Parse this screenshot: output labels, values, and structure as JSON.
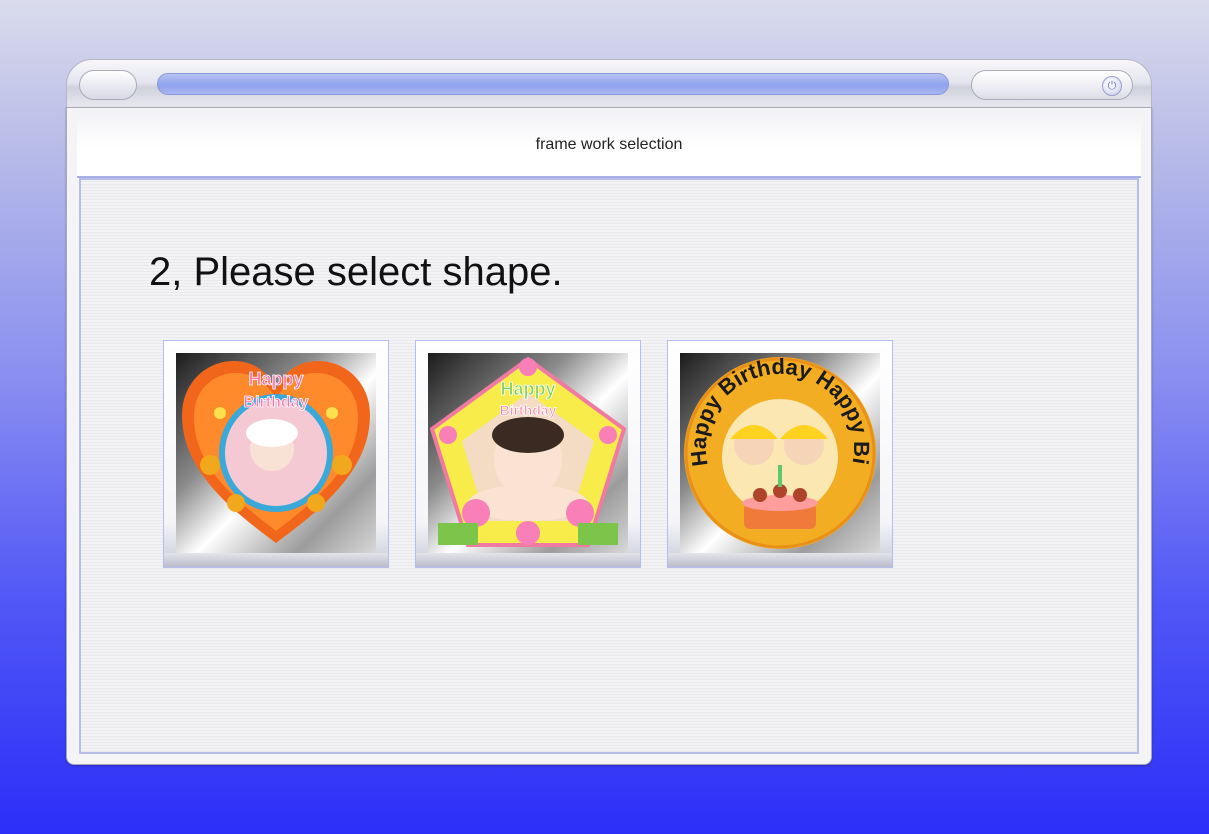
{
  "window": {
    "title": "frame work selection"
  },
  "main": {
    "prompt": "2, Please select shape."
  },
  "shapes": [
    {
      "name": "heart",
      "caption_top": "Happy",
      "caption_bottom": "Birthday"
    },
    {
      "name": "pentagon",
      "caption_top": "Happy",
      "caption_bottom": "Birthday"
    },
    {
      "name": "circle",
      "ring_text": "Happy Birthday Happy Birthday"
    }
  ],
  "icons": {
    "power": "power-icon"
  },
  "colors": {
    "accent": "#8fa2ee",
    "background_top": "#dadcec",
    "background_bottom": "#2c2ff8"
  }
}
